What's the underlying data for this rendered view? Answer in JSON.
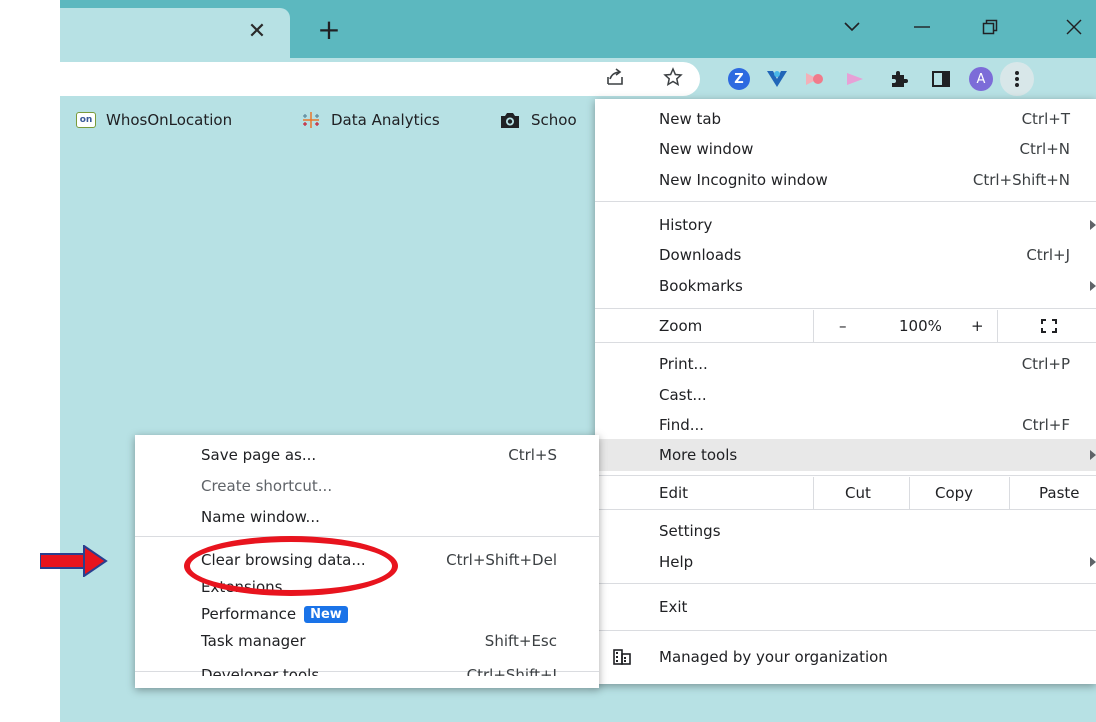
{
  "tabstrip": {
    "close_icon": "close-icon",
    "new_tab_icon": "plus-icon",
    "window_controls": [
      "tab-search-chevron-icon",
      "minimize-icon",
      "restore-icon",
      "close-window-icon"
    ]
  },
  "toolbar": {
    "profile_initial": "A",
    "extension_z_letter": "Z"
  },
  "bookmarks": [
    {
      "label": "WhosOnLocation",
      "badge": "on"
    },
    {
      "label": "Data Analytics"
    },
    {
      "label": "Schoo"
    }
  ],
  "menu": {
    "new_tab": {
      "label": "New tab",
      "shortcut": "Ctrl+T"
    },
    "new_window": {
      "label": "New window",
      "shortcut": "Ctrl+N"
    },
    "new_incognito": {
      "label": "New Incognito window",
      "shortcut": "Ctrl+Shift+N"
    },
    "history": {
      "label": "History"
    },
    "downloads": {
      "label": "Downloads",
      "shortcut": "Ctrl+J"
    },
    "bookmarks": {
      "label": "Bookmarks"
    },
    "zoom": {
      "label": "Zoom",
      "minus": "–",
      "value": "100%",
      "plus": "+"
    },
    "print": {
      "label": "Print...",
      "shortcut": "Ctrl+P"
    },
    "cast": {
      "label": "Cast..."
    },
    "find": {
      "label": "Find...",
      "shortcut": "Ctrl+F"
    },
    "more_tools": {
      "label": "More tools"
    },
    "edit": {
      "label": "Edit",
      "cut": "Cut",
      "copy": "Copy",
      "paste": "Paste"
    },
    "settings": {
      "label": "Settings"
    },
    "help": {
      "label": "Help"
    },
    "exit": {
      "label": "Exit"
    },
    "managed": {
      "label": "Managed by your organization"
    }
  },
  "submenu": {
    "save_page": {
      "label": "Save page as...",
      "shortcut": "Ctrl+S"
    },
    "create_shortcut": {
      "label": "Create shortcut..."
    },
    "name_window": {
      "label": "Name window..."
    },
    "clear_browsing": {
      "label": "Clear browsing data...",
      "shortcut": "Ctrl+Shift+Del"
    },
    "extensions": {
      "label": "Extensions"
    },
    "performance": {
      "label": "Performance",
      "badge": "New"
    },
    "task_manager": {
      "label": "Task manager",
      "shortcut": "Shift+Esc"
    },
    "developer_tools": {
      "label": "Developer tools",
      "shortcut": "Ctrl+Shift+I"
    }
  },
  "colors": {
    "frame": "#5cb8bf",
    "background": "#b7e1e4",
    "annotation_red": "#e8141e",
    "annotation_arrow_blue": "#2a3f8f",
    "new_badge": "#1a73e8"
  }
}
